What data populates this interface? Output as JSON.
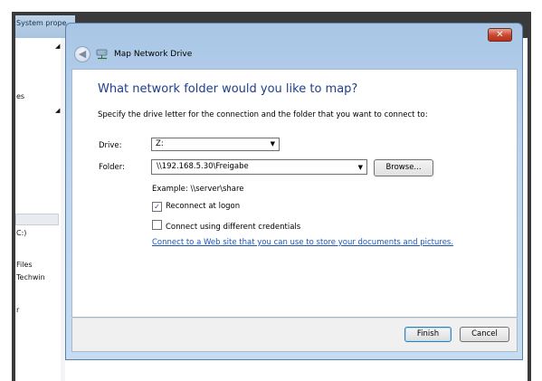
{
  "background_window": {
    "title": "System prope",
    "sidebar_labels": [
      "es",
      "C:)",
      "Files",
      "Techwin",
      "r"
    ],
    "colors": {
      "frame": "#3a3a3a",
      "titlebar": "#bcd3ea"
    }
  },
  "dialog": {
    "title": "Map Network Drive",
    "close_glyph": "✕",
    "back_glyph": "◀",
    "heading": "What network folder would you like to map?",
    "instruction": "Specify the drive letter for the connection and the folder that you want to connect to:",
    "drive": {
      "label": "Drive:",
      "value": "Z:",
      "caret": "▼"
    },
    "folder": {
      "label": "Folder:",
      "value": "\\\\192.168.5.30\\Freigabe",
      "caret": "▼"
    },
    "browse_label": "Browse...",
    "example": "Example: \\\\server\\share",
    "reconnect": {
      "label": "Reconnect at logon",
      "checked": true,
      "glyph": "✓"
    },
    "different_credentials": {
      "label": "Connect using different credentials",
      "checked": false
    },
    "link": "Connect to a Web site that you can use to store your documents and pictures.",
    "finish_label": "Finish",
    "cancel_label": "Cancel",
    "icons": {
      "back": "back-arrow-icon",
      "drive": "network-drive-icon",
      "close": "close-icon"
    },
    "colors": {
      "heading": "#1e3f8a",
      "link": "#1d56b8",
      "close": "#c8452f"
    }
  }
}
